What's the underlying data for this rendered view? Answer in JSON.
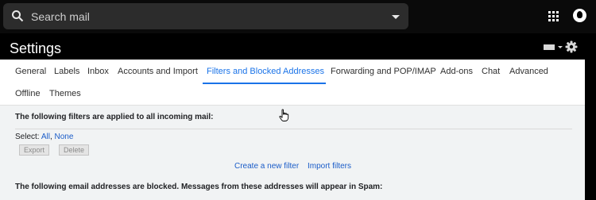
{
  "search": {
    "placeholder": "Search mail"
  },
  "header": {
    "title": "Settings"
  },
  "tabs": [
    {
      "label": "General"
    },
    {
      "label": "Labels"
    },
    {
      "label": "Inbox"
    },
    {
      "label": "Accounts and Import"
    },
    {
      "label": "Filters and Blocked Addresses",
      "active": true
    },
    {
      "label": "Forwarding and POP/IMAP"
    },
    {
      "label": "Add-ons"
    },
    {
      "label": "Chat"
    },
    {
      "label": "Advanced"
    },
    {
      "label": "Offline"
    },
    {
      "label": "Themes"
    }
  ],
  "filters": {
    "heading": "The following filters are applied to all incoming mail:",
    "select_label": "Select:",
    "select_all": "All",
    "select_sep": ",",
    "select_none": "None",
    "export_button": "Export",
    "delete_button": "Delete",
    "create_link": "Create a new filter",
    "import_link": "Import filters"
  },
  "blocked": {
    "heading": "The following email addresses are blocked. Messages from these addresses will appear in Spam:"
  },
  "colors": {
    "accent": "#1a73e8",
    "link": "#1a5cc8",
    "topbar": "#0a0a0a",
    "search_bg": "#2c2c2c"
  },
  "icons": [
    "search-icon",
    "dropdown-icon",
    "apps-icon",
    "account-icon",
    "density-icon",
    "gear-icon",
    "cursor-icon"
  ]
}
